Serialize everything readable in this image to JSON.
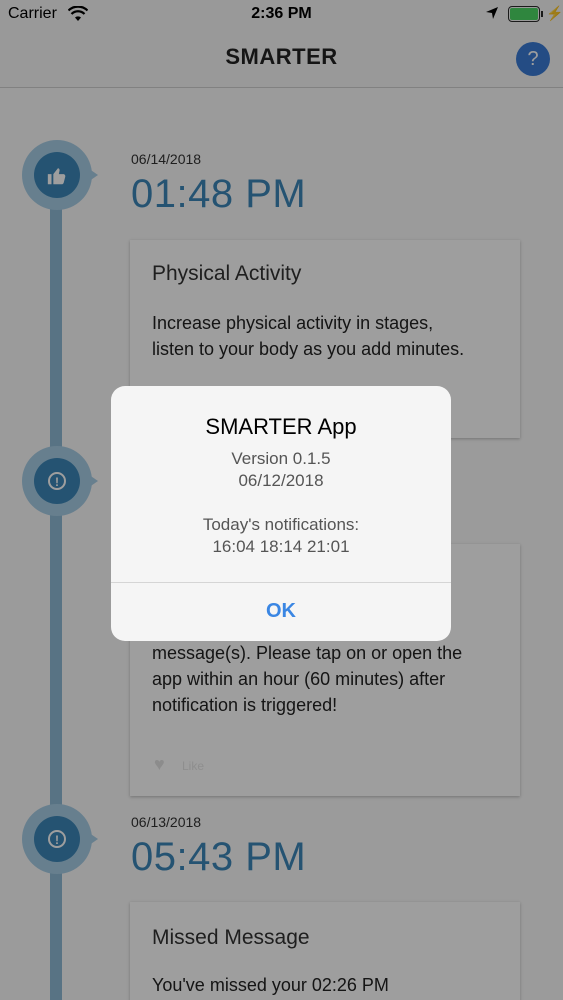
{
  "status_bar": {
    "carrier": "Carrier",
    "time": "2:36 PM"
  },
  "nav": {
    "title": "SMARTER",
    "help_icon": "?"
  },
  "timeline": [
    {
      "icon": "thumbs-up-icon",
      "date": "06/14/2018",
      "time": "01:48 PM",
      "card": {
        "title": "Physical Activity",
        "body": [
          "Increase physical activity in stages,",
          "listen to your body as you add minutes."
        ]
      }
    },
    {
      "icon": "exclamation-icon",
      "card": {
        "body": [
          "message(s). Please tap on or open the",
          "app within an hour (60 minutes) after",
          "notification is triggered!"
        ],
        "like_label": "Like"
      }
    },
    {
      "icon": "exclamation-icon",
      "date": "06/13/2018",
      "time": "05:43 PM",
      "card": {
        "title": "Missed Message",
        "body": [
          "You've missed your 02:26 PM"
        ]
      }
    }
  ],
  "alert": {
    "title": "SMARTER App",
    "version": "Version 0.1.5",
    "build_date": "06/12/2018",
    "notifications_label": "Today's notifications:",
    "notifications_times": "16:04 18:14 21:01",
    "ok_label": "OK"
  }
}
